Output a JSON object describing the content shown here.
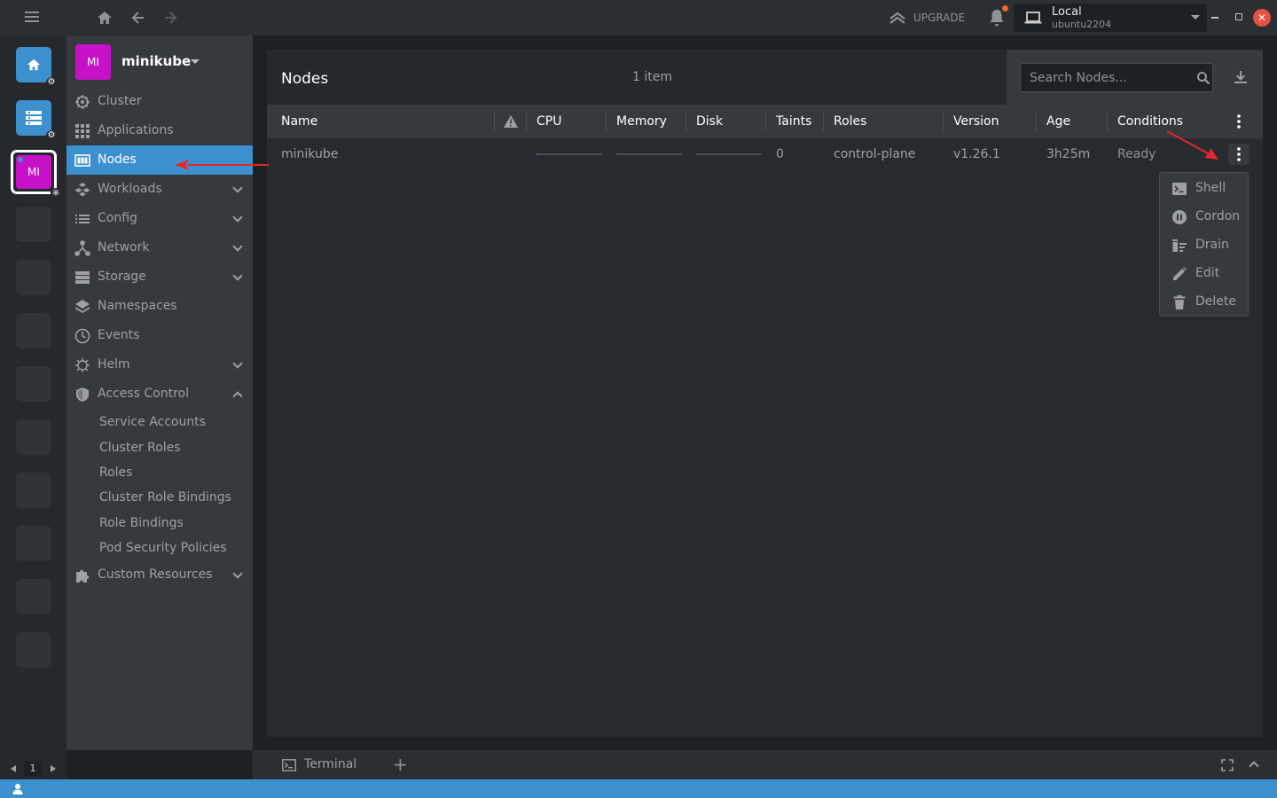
{
  "topbar": {
    "upgrade_label": "UPGRADE",
    "context": {
      "name": "Local",
      "host": "ubuntu2204"
    },
    "close_glyph": "✕"
  },
  "hotbar": {
    "cluster_abbr": "MI",
    "page_number": "1"
  },
  "sidebar": {
    "cluster_name": "minikube",
    "cluster_abbr": "MI",
    "items": [
      {
        "label": "Cluster",
        "icon": "cluster-icon"
      },
      {
        "label": "Applications",
        "icon": "grid-icon"
      },
      {
        "label": "Nodes",
        "icon": "nodes-icon"
      },
      {
        "label": "Workloads",
        "icon": "workloads-icon"
      },
      {
        "label": "Config",
        "icon": "list-icon"
      },
      {
        "label": "Network",
        "icon": "network-icon"
      },
      {
        "label": "Storage",
        "icon": "storage-icon"
      },
      {
        "label": "Namespaces",
        "icon": "layers-icon"
      },
      {
        "label": "Events",
        "icon": "clock-icon"
      },
      {
        "label": "Helm",
        "icon": "helm-icon"
      },
      {
        "label": "Access Control",
        "icon": "shield-icon"
      },
      {
        "label": "Custom Resources",
        "icon": "puzzle-icon"
      }
    ],
    "access_control_items": [
      "Service Accounts",
      "Cluster Roles",
      "Roles",
      "Cluster Role Bindings",
      "Role Bindings",
      "Pod Security Policies"
    ]
  },
  "main": {
    "title": "Nodes",
    "count": "1 item",
    "search_placeholder": "Search Nodes...",
    "columns": [
      "Name",
      "CPU",
      "Memory",
      "Disk",
      "Taints",
      "Roles",
      "Version",
      "Age",
      "Conditions"
    ],
    "rows": [
      {
        "name": "minikube",
        "cpu_fraction": 0.02,
        "memory_fraction": 0.0,
        "disk_fraction": 0.0,
        "taints": "0",
        "roles": "control-plane",
        "version": "v1.26.1",
        "age": "3h25m",
        "conditions": "Ready"
      }
    ]
  },
  "context_menu": {
    "items": [
      {
        "label": "Shell",
        "icon": "terminal-icon"
      },
      {
        "label": "Cordon",
        "icon": "pause-icon"
      },
      {
        "label": "Drain",
        "icon": "drain-icon"
      },
      {
        "label": "Edit",
        "icon": "pencil-icon"
      },
      {
        "label": "Delete",
        "icon": "trash-icon"
      }
    ]
  },
  "dock": {
    "terminal_label": "Terminal",
    "add_glyph": "+"
  },
  "colors": {
    "accent": "#3d90ce",
    "cluster_avatar": "#c711c9",
    "annotation": "#e8262a"
  }
}
